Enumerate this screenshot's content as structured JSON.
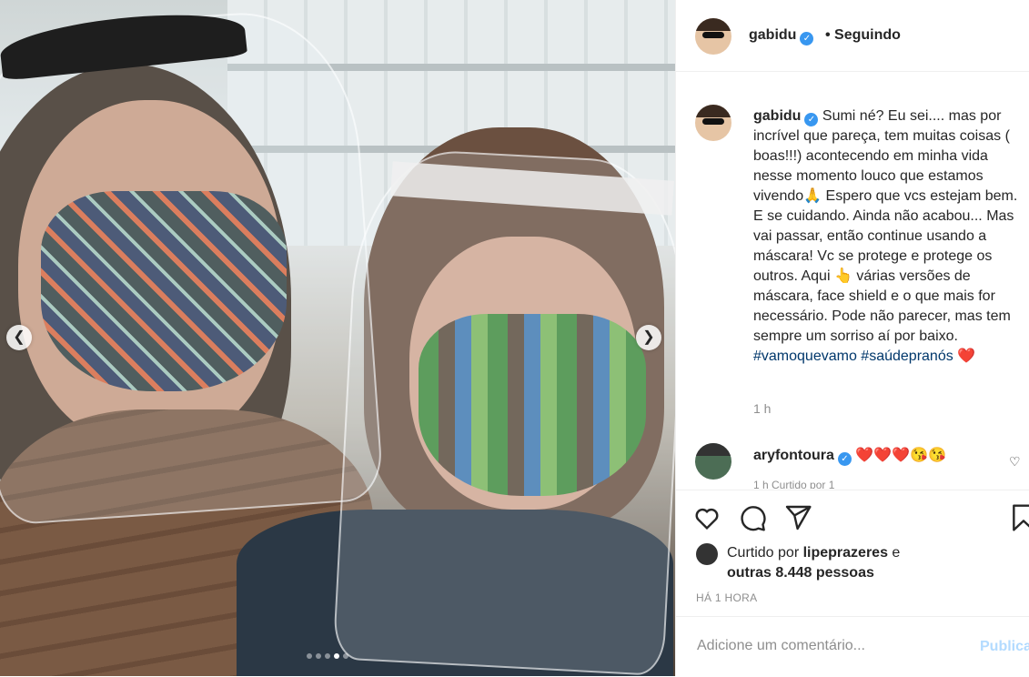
{
  "post": {
    "author": "gabidu",
    "follow_status": "• Seguindo",
    "caption": "Sumi né? Eu sei.... mas por incrível que pareça, tem muitas coisas ( boas!!!) acontecendo em minha vida nesse momento louco que estamos vivendo🙏 Espero que vcs estejam bem. E se cuidando. Ainda não acabou... Mas vai passar, então continue usando a máscara! Vc se protege e protege os outros. Aqui 👆 várias versões de máscara, face shield e o que mais for necessário. Pode não parecer, mas tem sempre um sorriso aí por baixo.",
    "hashtags": [
      "#vamoquevamo",
      "#saúdepranós"
    ],
    "hashtag_suffix": "❤️",
    "caption_time": "1 h",
    "carousel": {
      "slide_count": 5,
      "active_index": 3
    }
  },
  "comment": {
    "username": "aryfontoura",
    "text": "❤️❤️❤️😘😘",
    "subtext": "1 h   Curtido por 1"
  },
  "likes": {
    "prefix": "Curtido por ",
    "user": "lipeprazeres",
    "conj": " e",
    "others": "outras 8.448 pessoas"
  },
  "time_ago": "HÁ 1 HORA",
  "add_comment": {
    "placeholder": "Adicione um comentário...",
    "publish_label": "Publicar"
  },
  "icons": {
    "like": "heart-icon",
    "comment": "comment-icon",
    "share": "share-icon",
    "save": "bookmark-icon",
    "verified": "verified-badge-icon"
  },
  "colors": {
    "verified": "#3897f0",
    "hashtag": "#00376b",
    "publish_disabled": "#b3dbff",
    "muted": "#8e8e8e"
  }
}
